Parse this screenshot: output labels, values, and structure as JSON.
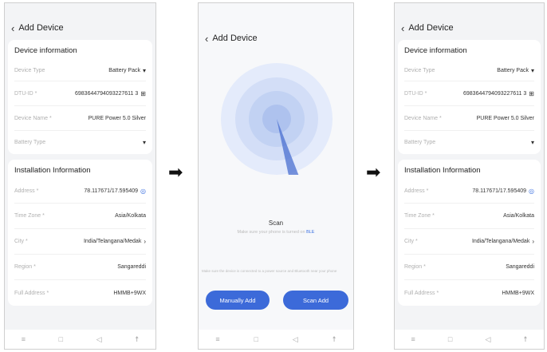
{
  "header": {
    "back_icon": "chevron-left-icon",
    "title": "Add Device"
  },
  "device_info": {
    "title": "Device information",
    "device_type": {
      "label": "Device Type",
      "value": "Battery Pack"
    },
    "dtu_id": {
      "label": "DTU-ID *",
      "value": "6983644794093227611 3"
    },
    "device_name": {
      "label": "Device Name *",
      "value": "PURE Power 5.0 Silver"
    },
    "battery_type": {
      "label": "Battery Type",
      "value": ""
    }
  },
  "installation_info": {
    "title": "Installation Information",
    "address": {
      "label": "Address *",
      "value": "78.117671/17.595409"
    },
    "time_zone": {
      "label": "Time Zone *",
      "value": "Asia/Kolkata"
    },
    "city": {
      "label": "City *",
      "value": "India/Telangana/Medak"
    },
    "region": {
      "label": "Region *",
      "value": "Sangareddi"
    },
    "full_address": {
      "label": "Full Address *",
      "value": "HMMB+9WX"
    }
  },
  "scan_screen": {
    "title": "Add Device",
    "scan_label": "Scan",
    "scan_hint_prefix": "Make sure your phone is turned on ",
    "scan_hint_ble": "BLE",
    "note": "Make sure the device is connected to a power source and Bluetooth near your phone",
    "manual_add": "Manually Add",
    "scan_add": "Scan Add"
  },
  "arrows": [
    "➡",
    "➡"
  ],
  "colors": {
    "accent": "#3c6ad9",
    "radar": "#c7d6f5"
  }
}
